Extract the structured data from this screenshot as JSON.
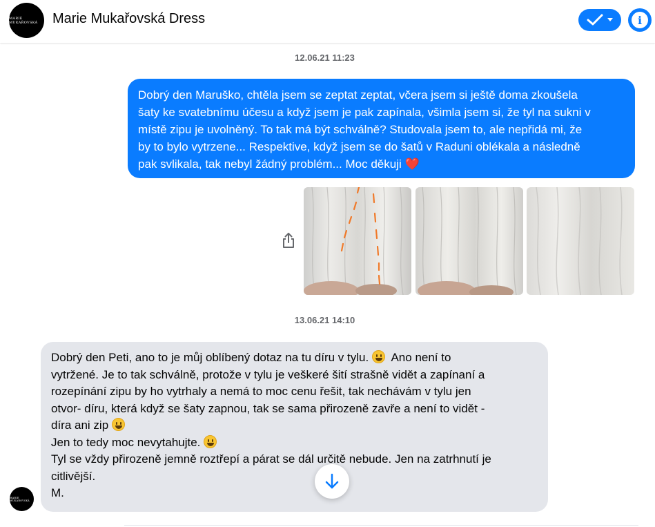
{
  "header": {
    "title": "Marie Mukařovská Dress",
    "avatar_text": "MARIE MUKAŘOVSKÁ",
    "check_icon": "check-icon",
    "dropdown_icon": "caret-down-icon",
    "info_icon": "info-icon",
    "info_label": "i"
  },
  "colors": {
    "accent": "#0a7cff",
    "incoming_bubble": "#e4e6eb",
    "timestamp": "#65676b"
  },
  "messages": [
    {
      "timestamp": "12.06.21 11:23",
      "direction": "outgoing",
      "lines": [
        "Dobrý den Maruško, chtěla jsem se zeptat zeptat, včera jsem si ještě doma zkoušela",
        "šaty ke svatebnímu účesu a když jsem je pak zapínala, všimla jsem si, že tyl na sukni v",
        "místě zipu je uvolněný. To tak má být schválně? Studovala jsem to, ale nepřidá mi, že",
        "by to bylo vytrzene... Respektive, když jsem se do šatů v Raduni oblékala a následně",
        "pak svlikala, tak nebyl žádný problém... Moc děkuji"
      ],
      "trailing_emoji": "❤️",
      "attachments": [
        "photo-1",
        "photo-2",
        "photo-3"
      ]
    },
    {
      "timestamp": "13.06.21 14:10",
      "direction": "incoming",
      "lines": [
        "Dobrý den Peti, ano to je můj oblíbený dotaz na tu díru v tylu.",
        "Ano není to",
        "vytržené. Je to tak schválně, protože v tylu je veškeré šití strašně vidět a zapínaní a",
        "rozepínání zipu by ho vytrhaly a nemá to moc cenu  řešit, tak nechávám v tylu jen",
        "otvor- díru, která když se šaty zapnou, tak se sama přirozeně zavře a není to vidět -",
        "díra ani zip",
        "Jen to tedy moc nevytahujte.",
        "Tyl se vždy přirozeně jemně  roztřepí a párat se dál určitě nebude. Jen na zatrhnutí je",
        "citlivější.",
        "M."
      ],
      "emoji_name": "grinning-face-emoji"
    }
  ],
  "controls": {
    "share_icon": "share-icon",
    "scroll_down_icon": "arrow-down-icon"
  }
}
